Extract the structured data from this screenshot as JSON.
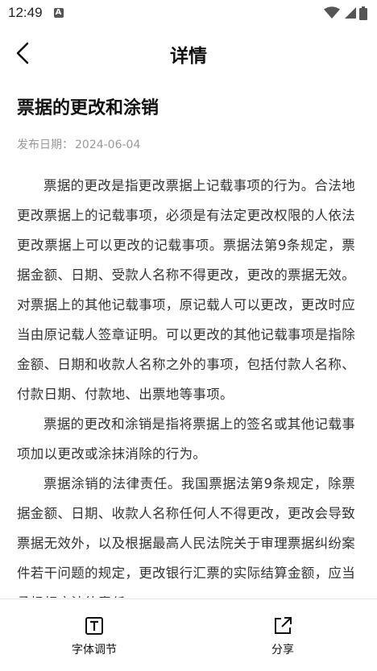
{
  "status_bar": {
    "time": "12:49",
    "app_icon_letter": "A",
    "icons": [
      "wifi-icon",
      "signal-icon",
      "battery-icon"
    ]
  },
  "header": {
    "title": "详情",
    "back_icon": "chevron-left-icon"
  },
  "article": {
    "title": "票据的更改和涂销",
    "date_label": "发布日期：",
    "date_value": "2024-06-04",
    "paragraphs": [
      "票据的更改是指更改票据上记载事项的行为。合法地更改票据上的记载事项，必须是有法定更改权限的人依法更改票据上可以更改的记载事项。票据法第9条规定，票据金额、日期、受款人名称不得更改，更改的票据无效。对票据上的其他记载事项，原记载人可以更改，更改时应当由原记载人签章证明。可以更改的其他记载事项是指除金额、日期和收款人名称之外的事项，包括付款人名称、付款日期、付款地、出票地等事项。",
      "票据的更改和涂销是指将票据上的签名或其他记载事项加以更改或涂抹消除的行为。",
      "票据涂销的法律责任。我国票据法第9条规定，除票据金额、日期、收款人名称任何人不得更改，更改会导致票据无效外，以及根据最高人民法院关于审理票据纠纷案件若干问题的规定，更改银行汇票的实际结算金额，应当承担相应法律责任。"
    ]
  },
  "bottom_bar": {
    "font_label": "字体调节",
    "font_icon": "text-size-icon",
    "share_label": "分享",
    "share_icon": "share-icon"
  }
}
